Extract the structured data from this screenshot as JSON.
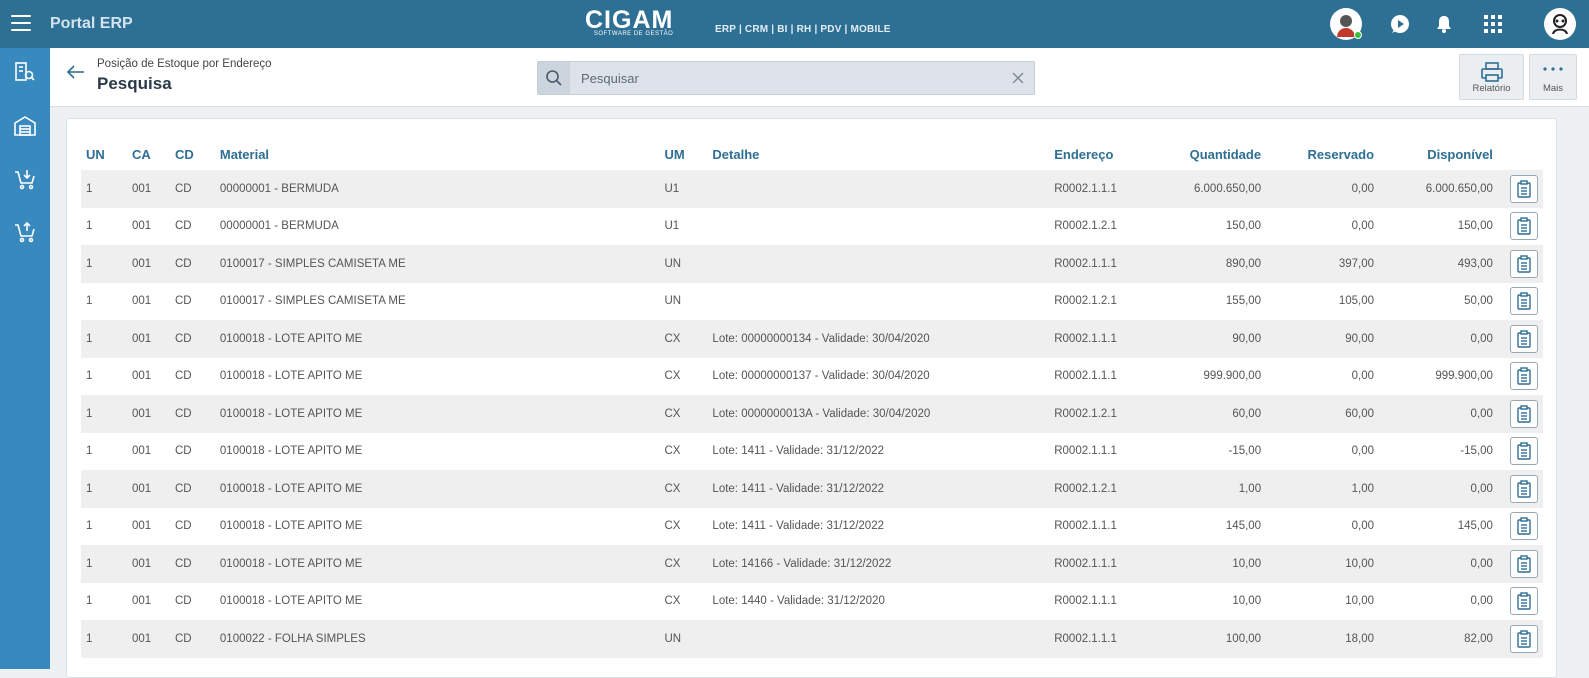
{
  "topbar": {
    "app_title": "Portal ERP",
    "logo": {
      "main": "CIGAM",
      "sub": "SOFTWARE DE GESTÃO"
    },
    "modules": "ERP | CRM | BI | RH | PDV | MOBILE"
  },
  "header": {
    "breadcrumb": "Posição de Estoque por Endereço",
    "title": "Pesquisa",
    "search_placeholder": "Pesquisar",
    "report_label": "Relatório",
    "more_label": "Mais"
  },
  "table": {
    "columns": {
      "un": "UN",
      "ca": "CA",
      "cd": "CD",
      "material": "Material",
      "um": "UM",
      "detalhe": "Detalhe",
      "endereco": "Endereço",
      "quantidade": "Quantidade",
      "reservado": "Reservado",
      "disponivel": "Disponível"
    },
    "rows": [
      {
        "un": "1",
        "ca": "001",
        "cd": "CD",
        "material": "00000001 - BERMUDA",
        "um": "U1",
        "detalhe": "",
        "endereco": "R0002.1.1.1",
        "quantidade": "6.000.650,00",
        "reservado": "0,00",
        "disponivel": "6.000.650,00"
      },
      {
        "un": "1",
        "ca": "001",
        "cd": "CD",
        "material": "00000001 - BERMUDA",
        "um": "U1",
        "detalhe": "",
        "endereco": "R0002.1.2.1",
        "quantidade": "150,00",
        "reservado": "0,00",
        "disponivel": "150,00"
      },
      {
        "un": "1",
        "ca": "001",
        "cd": "CD",
        "material": "0100017 - SIMPLES CAMISETA ME",
        "um": "UN",
        "detalhe": "",
        "endereco": "R0002.1.1.1",
        "quantidade": "890,00",
        "reservado": "397,00",
        "disponivel": "493,00"
      },
      {
        "un": "1",
        "ca": "001",
        "cd": "CD",
        "material": "0100017 - SIMPLES CAMISETA ME",
        "um": "UN",
        "detalhe": "",
        "endereco": "R0002.1.2.1",
        "quantidade": "155,00",
        "reservado": "105,00",
        "disponivel": "50,00"
      },
      {
        "un": "1",
        "ca": "001",
        "cd": "CD",
        "material": "0100018 - LOTE APITO ME",
        "um": "CX",
        "detalhe": "Lote: 00000000134 - Validade: 30/04/2020",
        "endereco": "R0002.1.1.1",
        "quantidade": "90,00",
        "reservado": "90,00",
        "disponivel": "0,00"
      },
      {
        "un": "1",
        "ca": "001",
        "cd": "CD",
        "material": "0100018 - LOTE APITO ME",
        "um": "CX",
        "detalhe": "Lote: 00000000137 - Validade: 30/04/2020",
        "endereco": "R0002.1.1.1",
        "quantidade": "999.900,00",
        "reservado": "0,00",
        "disponivel": "999.900,00"
      },
      {
        "un": "1",
        "ca": "001",
        "cd": "CD",
        "material": "0100018 - LOTE APITO ME",
        "um": "CX",
        "detalhe": "Lote: 0000000013A - Validade: 30/04/2020",
        "endereco": "R0002.1.2.1",
        "quantidade": "60,00",
        "reservado": "60,00",
        "disponivel": "0,00"
      },
      {
        "un": "1",
        "ca": "001",
        "cd": "CD",
        "material": "0100018 - LOTE APITO ME",
        "um": "CX",
        "detalhe": "Lote: 1411 - Validade: 31/12/2022",
        "endereco": "R0002.1.1.1",
        "quantidade": "-15,00",
        "reservado": "0,00",
        "disponivel": "-15,00"
      },
      {
        "un": "1",
        "ca": "001",
        "cd": "CD",
        "material": "0100018 - LOTE APITO ME",
        "um": "CX",
        "detalhe": "Lote: 1411 - Validade: 31/12/2022",
        "endereco": "R0002.1.2.1",
        "quantidade": "1,00",
        "reservado": "1,00",
        "disponivel": "0,00"
      },
      {
        "un": "1",
        "ca": "001",
        "cd": "CD",
        "material": "0100018 - LOTE APITO ME",
        "um": "CX",
        "detalhe": "Lote: 1411 - Validade: 31/12/2022",
        "endereco": "R0002.1.1.1",
        "quantidade": "145,00",
        "reservado": "0,00",
        "disponivel": "145,00"
      },
      {
        "un": "1",
        "ca": "001",
        "cd": "CD",
        "material": "0100018 - LOTE APITO ME",
        "um": "CX",
        "detalhe": "Lote: 14166 - Validade: 31/12/2022",
        "endereco": "R0002.1.1.1",
        "quantidade": "10,00",
        "reservado": "10,00",
        "disponivel": "0,00"
      },
      {
        "un": "1",
        "ca": "001",
        "cd": "CD",
        "material": "0100018 - LOTE APITO ME",
        "um": "CX",
        "detalhe": "Lote: 1440 - Validade: 31/12/2020",
        "endereco": "R0002.1.1.1",
        "quantidade": "10,00",
        "reservado": "10,00",
        "disponivel": "0,00"
      },
      {
        "un": "1",
        "ca": "001",
        "cd": "CD",
        "material": "0100022 - FOLHA SIMPLES",
        "um": "UN",
        "detalhe": "",
        "endereco": "R0002.1.1.1",
        "quantidade": "100,00",
        "reservado": "18,00",
        "disponivel": "82,00"
      }
    ]
  },
  "icons": {
    "menu": "hamburger-menu-icon",
    "chat": "chat-play-icon",
    "bell": "bell-icon",
    "apps": "apps-grid-icon",
    "profile": "profile-avatar-icon",
    "sidebar": [
      "building-search-icon",
      "warehouse-icon",
      "basket-in-icon",
      "basket-out-icon"
    ],
    "row_action": "clipboard-icon"
  },
  "colors": {
    "topbar": "#2e6f94",
    "sidebar": "#3889bd",
    "header_text": "#2e6f94"
  }
}
